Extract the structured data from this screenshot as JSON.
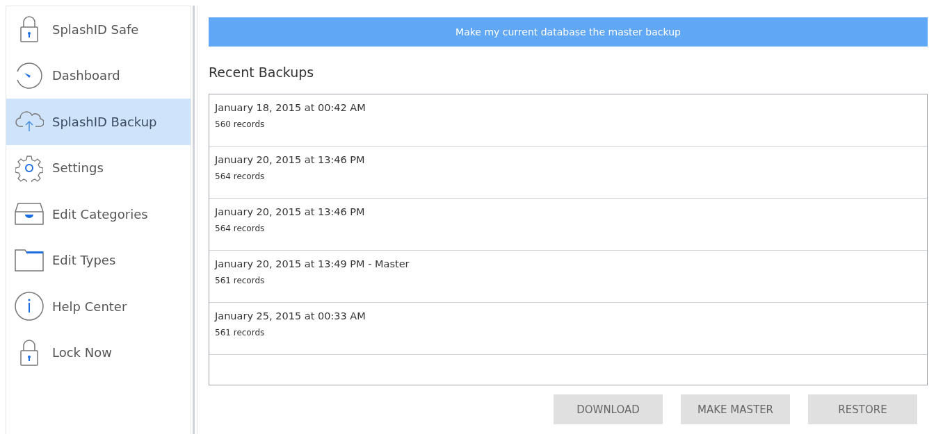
{
  "sidebar": {
    "items": [
      {
        "label": "SplashID Safe",
        "selected": false
      },
      {
        "label": "Dashboard",
        "selected": false
      },
      {
        "label": "SplashID Backup",
        "selected": true
      },
      {
        "label": "Settings",
        "selected": false
      },
      {
        "label": "Edit Categories",
        "selected": false
      },
      {
        "label": "Edit Types",
        "selected": false
      },
      {
        "label": "Help Center",
        "selected": false
      },
      {
        "label": "Lock Now",
        "selected": false
      }
    ]
  },
  "banner_button": "Make my current database the master backup",
  "heading": "Recent Backups",
  "backups": [
    {
      "date": "January 18, 2015 at 00:42 AM",
      "records": "560 records"
    },
    {
      "date": "January 20, 2015 at 13:46 PM",
      "records": "564 records"
    },
    {
      "date": "January 20, 2015 at 13:46 PM",
      "records": "564 records"
    },
    {
      "date": "January 20, 2015 at 13:49 PM - Master",
      "records": "561 records"
    },
    {
      "date": "January 25, 2015 at 00:33 AM",
      "records": "561 records"
    }
  ],
  "buttons": [
    "DOWNLOAD",
    "MAKE MASTER",
    "RESTORE"
  ]
}
